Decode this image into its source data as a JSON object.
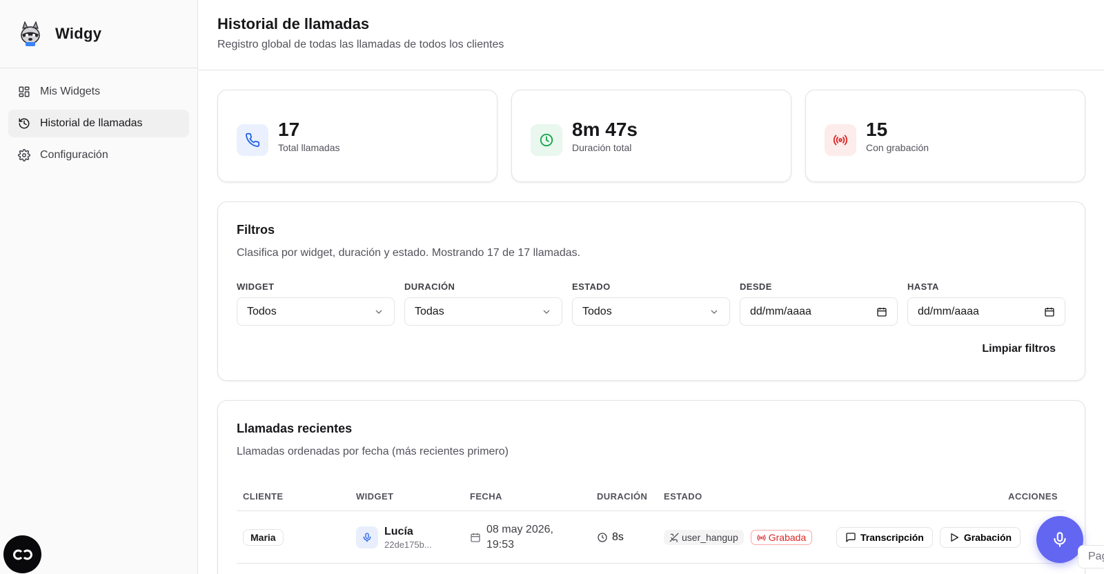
{
  "sidebar": {
    "brand": "Widgy",
    "items": [
      {
        "label": "Mis Widgets",
        "icon": "grid-icon"
      },
      {
        "label": "Historial de llamadas",
        "icon": "history-icon",
        "active": true
      },
      {
        "label": "Configuración",
        "icon": "gear-icon"
      }
    ]
  },
  "header": {
    "title": "Historial de llamadas",
    "subtitle": "Registro global de todas las llamadas de todos los clientes"
  },
  "stats": [
    {
      "value": "17",
      "label": "Total llamadas",
      "icon": "phone-icon",
      "color": "#2563eb",
      "bg": "#eaf0fe"
    },
    {
      "value": "8m 47s",
      "label": "Duración total",
      "icon": "clock-icon",
      "color": "#16a34a",
      "bg": "#e9f7ee"
    },
    {
      "value": "15",
      "label": "Con grabación",
      "icon": "radio-icon",
      "color": "#dc2626",
      "bg": "#fdecec"
    }
  ],
  "filters": {
    "title": "Filtros",
    "description": "Clasifica por widget, duración y estado. Mostrando 17 de 17 llamadas.",
    "fields": [
      {
        "label": "Widget",
        "value": "Todos",
        "type": "select"
      },
      {
        "label": "Duración",
        "value": "Todas",
        "type": "select"
      },
      {
        "label": "Estado",
        "value": "Todos",
        "type": "select"
      },
      {
        "label": "Desde",
        "value": "dd/mm/aaaa",
        "type": "date"
      },
      {
        "label": "Hasta",
        "value": "dd/mm/aaaa",
        "type": "date"
      }
    ],
    "clear_label": "Limpiar filtros"
  },
  "recent": {
    "title": "Llamadas recientes",
    "description": "Llamadas ordenadas por fecha (más recientes primero)",
    "columns": [
      "CLIENTE",
      "WIDGET",
      "FECHA",
      "DURACIÓN",
      "ESTADO",
      "ACCIONES"
    ],
    "rows": [
      {
        "client": "Maria",
        "widget_name": "Lucía",
        "widget_id": "22de175b...",
        "date_line1": "08 may 2026,",
        "date_line2": "19:53",
        "duration": "8s",
        "status": "user_hangup",
        "recorded": "Grabada",
        "actions": [
          "Transcripción",
          "Grabación"
        ]
      }
    ]
  },
  "peek_text": "Pag",
  "colors": {
    "accent": "#6366f1",
    "recorded": "#dc2626"
  }
}
